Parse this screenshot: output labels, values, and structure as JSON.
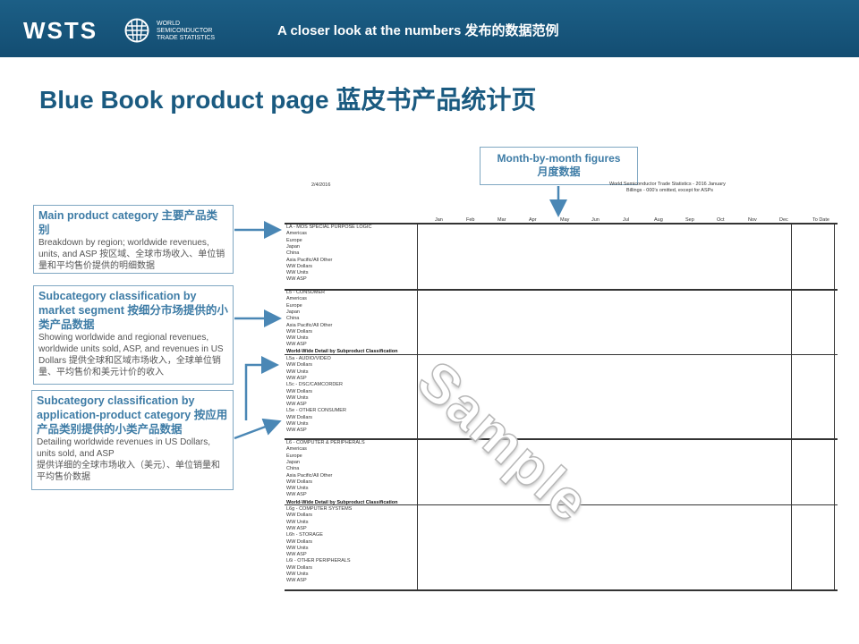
{
  "header": {
    "logo_text": "WSTS",
    "logo_sub": "WORLD\nSEMICONDUCTOR\nTRADE STATISTICS",
    "title": "A closer look at the numbers 发布的数据范例"
  },
  "page_title": "Blue Book product page 蓝皮书产品统计页",
  "callouts": {
    "main": {
      "title": "Main product category 主要产品类别",
      "body": "Breakdown by region; worldwide revenues, units, and ASP 按区域、全球市场收入、单位销量和平均售价提供的明细数据"
    },
    "sub1": {
      "title": "Subcategory classification by market segment 按细分市场提供的小类产品数据",
      "body": "Showing worldwide and regional revenues, worldwide units sold, ASP, and revenues in US Dollars 提供全球和区域市场收入，全球单位销量、平均售价和美元计价的收入"
    },
    "sub2": {
      "title": "Subcategory classification by application-product category 按应用产品类别提供的小类产品数据",
      "body": "Detailing  worldwide revenues in US Dollars, units sold, and ASP\n提供详细的全球市场收入（美元）、单位销量和平均售价数据"
    },
    "month": {
      "title": "Month-by-month  figures",
      "subtitle": "月度数据"
    }
  },
  "sheet": {
    "date": "2/4/2016",
    "source_line1": "World Semiconductor Trade Statistics - 2016 January",
    "source_line2": "Billings - 000's omitted, except for ASPs",
    "months": [
      "Jan",
      "Feb",
      "Mar",
      "Apr",
      "May",
      "Jun",
      "Jul",
      "Aug",
      "Sep",
      "Oct",
      "Nov",
      "Dec"
    ],
    "to_date": "To Date",
    "block1": [
      "LA - MOS SPECIAL PURPOSE LOGIC",
      "Americas",
      "Europe",
      "Japan",
      "China",
      "Asia Pacific/All Other",
      "WW Dollars",
      "WW Units",
      "WW ASP"
    ],
    "block2": [
      "L5 - CONSUMER",
      "Americas",
      "Europe",
      "Japan",
      "China",
      "Asia Pacific/All Other",
      "WW Dollars",
      "WW Units",
      "WW ASP"
    ],
    "detail_heading": "World-Wide Detail by Subproduct Classification",
    "block3": [
      "L5a - AUDIO/VIDEO",
      "WW Dollars",
      "WW Units",
      "WW ASP",
      "L5c - DSC/CAMCORDER",
      "WW Dollars",
      "WW Units",
      "WW ASP",
      "L5e - OTHER CONSUMER",
      "WW Dollars",
      "WW Units",
      "WW ASP"
    ],
    "block4": [
      "L6 - COMPUTER & PERIPHERALS",
      "Americas",
      "Europe",
      "Japan",
      "China",
      "Asia Pacific/All Other",
      "WW Dollars",
      "WW Units",
      "WW ASP"
    ],
    "block5": [
      "L6g - COMPUTER SYSTEMS",
      "WW Dollars",
      "WW Units",
      "WW ASP",
      "L6h - STORAGE",
      "WW Dollars",
      "WW Units",
      "WW ASP",
      "L6i - OTHER PERIPHERALS",
      "WW Dollars",
      "WW Units",
      "WW ASP"
    ],
    "watermark": "Sample"
  }
}
